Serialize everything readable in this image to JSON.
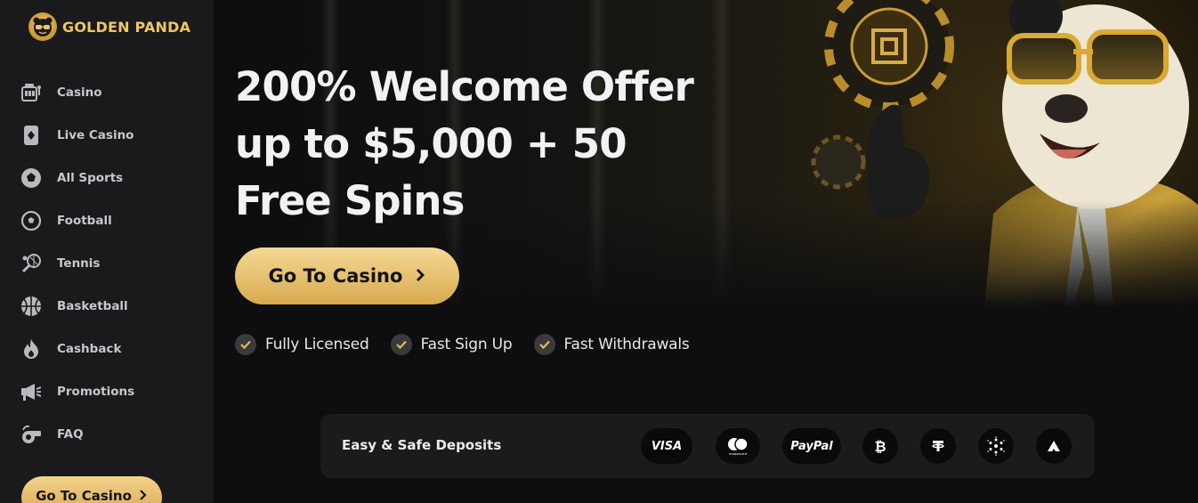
{
  "brand": {
    "name": "GOLDEN PANDA",
    "gold": "#f0c660",
    "cta_gradient": [
      "#f4d996",
      "#d8a94f"
    ]
  },
  "sidebar": {
    "items": [
      {
        "label": "Casino",
        "icon": "slot-machine-icon"
      },
      {
        "label": "Live Casino",
        "icon": "playing-card-icon"
      },
      {
        "label": "All Sports",
        "icon": "sports-ball-icon"
      },
      {
        "label": "Football",
        "icon": "football-icon"
      },
      {
        "label": "Tennis",
        "icon": "tennis-icon"
      },
      {
        "label": "Basketball",
        "icon": "basketball-icon"
      },
      {
        "label": "Cashback",
        "icon": "flame-icon"
      },
      {
        "label": "Promotions",
        "icon": "megaphone-icon"
      },
      {
        "label": "FAQ",
        "icon": "whistle-icon"
      }
    ],
    "cta_label": "Go To Casino"
  },
  "hero": {
    "title_lines": [
      "200% Welcome Offer",
      "up to $5,000 + 50",
      "Free Spins"
    ],
    "cta_label": "Go To Casino"
  },
  "features": [
    "Fully Licensed",
    "Fast Sign Up",
    "Fast Withdrawals"
  ],
  "deposits": {
    "label": "Easy & Safe Deposits",
    "methods": [
      "VISA",
      "mastercard",
      "PayPal",
      "bitcoin",
      "tether",
      "cardano",
      "avalanche"
    ]
  }
}
